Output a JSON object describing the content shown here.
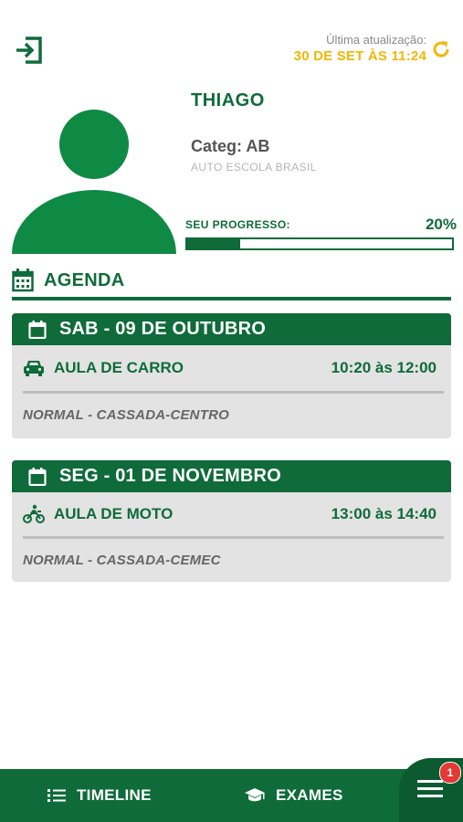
{
  "header": {
    "update_label": "Última atualização:",
    "update_value": "30 DE SET ÀS 11:24",
    "accent_color": "#f2b705"
  },
  "profile": {
    "name": "THIAGO",
    "category": "Categ: AB",
    "school": "AUTO ESCOLA BRASIL",
    "progress_label": "SEU PROGRESSO:",
    "progress_text": "20%",
    "progress_value": 0.2
  },
  "agenda": {
    "title": "AGENDA",
    "items": [
      {
        "date": "SAB - 09 DE OUTUBRO",
        "lesson": "AULA DE CARRO",
        "lesson_icon": "car-icon",
        "time": "10:20 às 12:00",
        "detail": "NORMAL - CASSADA-CENTRO"
      },
      {
        "date": "SEG - 01 DE NOVEMBRO",
        "lesson": "AULA DE MOTO",
        "lesson_icon": "motorcycle-icon",
        "time": "13:00 às 14:40",
        "detail": "NORMAL - CASSADA-CEMEC"
      }
    ]
  },
  "nav": {
    "timeline": "TIMELINE",
    "exames": "EXAMES",
    "menu_badge": "1"
  },
  "colors": {
    "brand": "#0f6b3a",
    "badge": "#e53935"
  }
}
